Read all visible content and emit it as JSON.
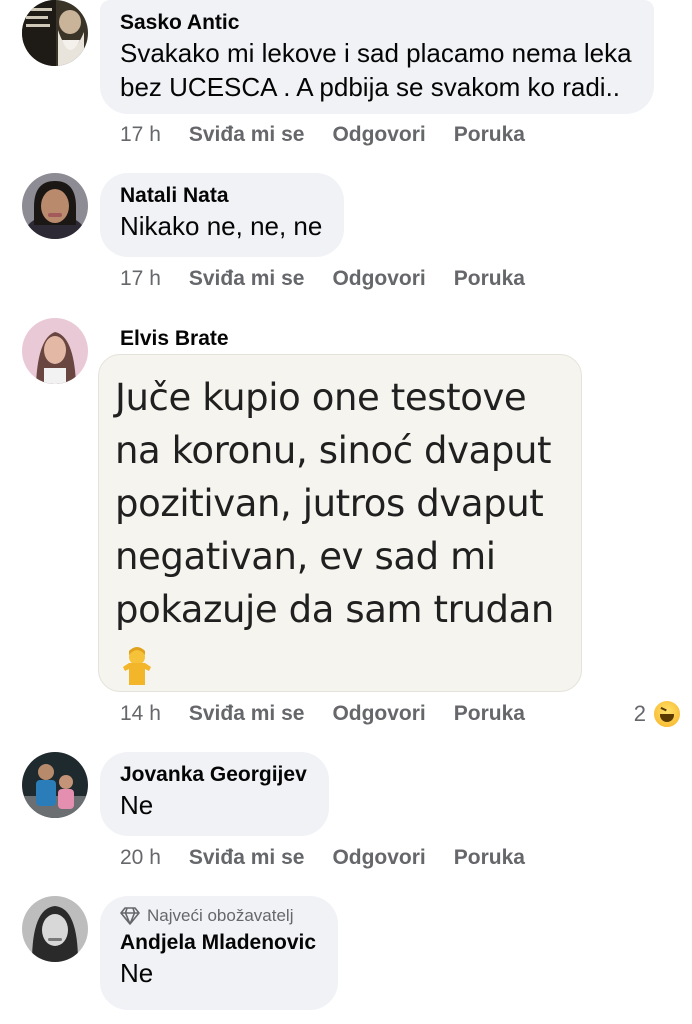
{
  "comments": [
    {
      "author": "Sasko Antic",
      "text_lines": [
        "Svakako mi lekove i sad placamo nema leka",
        "bez UCESCA . A pdbija se svakom ko radi.."
      ],
      "time": "17 h",
      "like": "Sviđa mi se",
      "reply": "Odgovori",
      "message": "Poruka"
    },
    {
      "author": "Natali Nata",
      "text_lines": [
        "Nikako ne, ne, ne"
      ],
      "time": "17 h",
      "like": "Sviđa mi se",
      "reply": "Odgovori",
      "message": "Poruka"
    },
    {
      "author": "Elvis Brate",
      "image_text_lines": [
        "Juče kupio one testove",
        "na koronu, sinoć dvaput",
        "pozitivan, jutros dvaput",
        "negativan, ev sad mi",
        "pokazuje da sam trudan"
      ],
      "image_emoji": "person-shrugging-emoji",
      "time": "14 h",
      "like": "Sviđa mi se",
      "reply": "Odgovori",
      "message": "Poruka",
      "reaction_count": "2",
      "reaction_icon": "haha-reaction-icon"
    },
    {
      "author": "Jovanka Georgijev",
      "text_lines": [
        "Ne"
      ],
      "time": "20 h",
      "like": "Sviđa mi se",
      "reply": "Odgovori",
      "message": "Poruka"
    },
    {
      "badge": "Najveći obožavatelj",
      "badge_icon": "diamond-icon",
      "author": "Andjela Mladenovic",
      "text_lines": [
        "Ne"
      ]
    }
  ],
  "colors": {
    "bubble": "#f0f2f5",
    "secondary_text": "#65676b",
    "primary_text": "#050505"
  }
}
